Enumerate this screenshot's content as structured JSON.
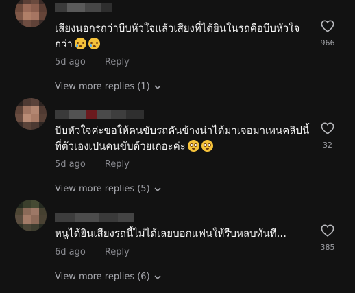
{
  "comments": [
    {
      "text": "เสียงนอกรถว่าบีบหัวใจแล้วเสียงที่ได้ยินในรถคือบีบหัวใจกว่า",
      "time": "5d ago",
      "reply_label": "Reply",
      "view_more": "View more replies (1)",
      "likes": "966",
      "emoji": [
        "sad-tear-emoji",
        "sad-tear-emoji"
      ]
    },
    {
      "text": "บีบหัวใจค่ะขอให้คนขับรถคันข้างน่าได้มาเจอมาเหนคลิปนี้ที่ตัวเองเปนคนขับด้วยเถอะค่ะ",
      "time": "5d ago",
      "reply_label": "Reply",
      "view_more": "View more replies (5)",
      "likes": "32",
      "emoji": [
        "flushed-emoji",
        "flushed-emoji"
      ]
    },
    {
      "text": "หนูได้ยินเสียงรถนี้ไม่ได้เลยบอกแฟนให้รีบหลบทันที...",
      "time": "6d ago",
      "reply_label": "Reply",
      "view_more": "View more replies (6)",
      "likes": "385",
      "emoji": []
    }
  ],
  "colors": {
    "background": "#121212",
    "text": "#f3f3f3",
    "muted": "#8a8b91",
    "heart_outline": "#b8b9bd"
  },
  "icons": {
    "like": "heart-outline-icon",
    "expand": "chevron-down-icon"
  }
}
